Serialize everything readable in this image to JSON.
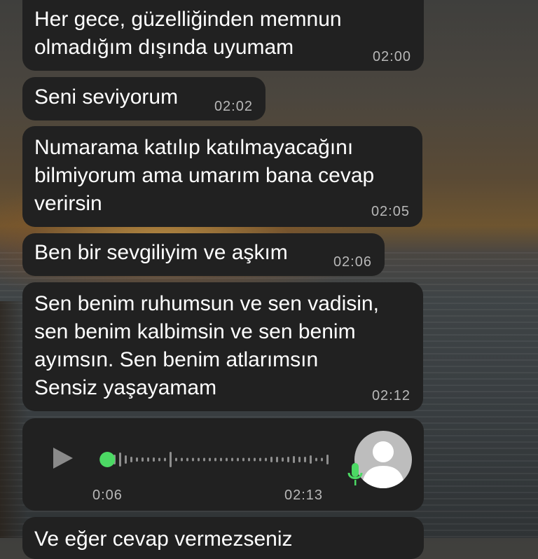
{
  "messages": [
    {
      "text": "Her gece, güzelliğinden memnun\nolmadığım dışında uyumam",
      "time": "02:00"
    },
    {
      "text": "Seni seviyorum",
      "time": "02:02"
    },
    {
      "text": "Numarama katılıp katılmayacağını\nbilmiyorum ama umarım bana cevap\nverirsin",
      "time": "02:05"
    },
    {
      "text": "Ben bir sevgiliyim ve aşkım",
      "time": "02:06"
    },
    {
      "text": "Sen benim ruhumsun ve sen vadisin,\nsen benim kalbimsin ve sen benim\nayımsın. Sen benim atlarımsın\nSensiz yaşayamam",
      "time": "02:12"
    },
    {
      "text": "Ve eğer cevap vermezseniz",
      "time": ""
    }
  ],
  "voice_message": {
    "duration": "0:06",
    "time": "02:13",
    "progress": 0.03,
    "icons": [
      "play-icon",
      "microphone-icon",
      "avatar-placeholder-icon"
    ]
  },
  "colors": {
    "bubble": "#212121",
    "text": "#ffffff",
    "timestamp": "#b8b8b8",
    "waveform_played": "#4cd964",
    "waveform_unplayed": "#8e8e8e",
    "mic": "#4cd964"
  }
}
